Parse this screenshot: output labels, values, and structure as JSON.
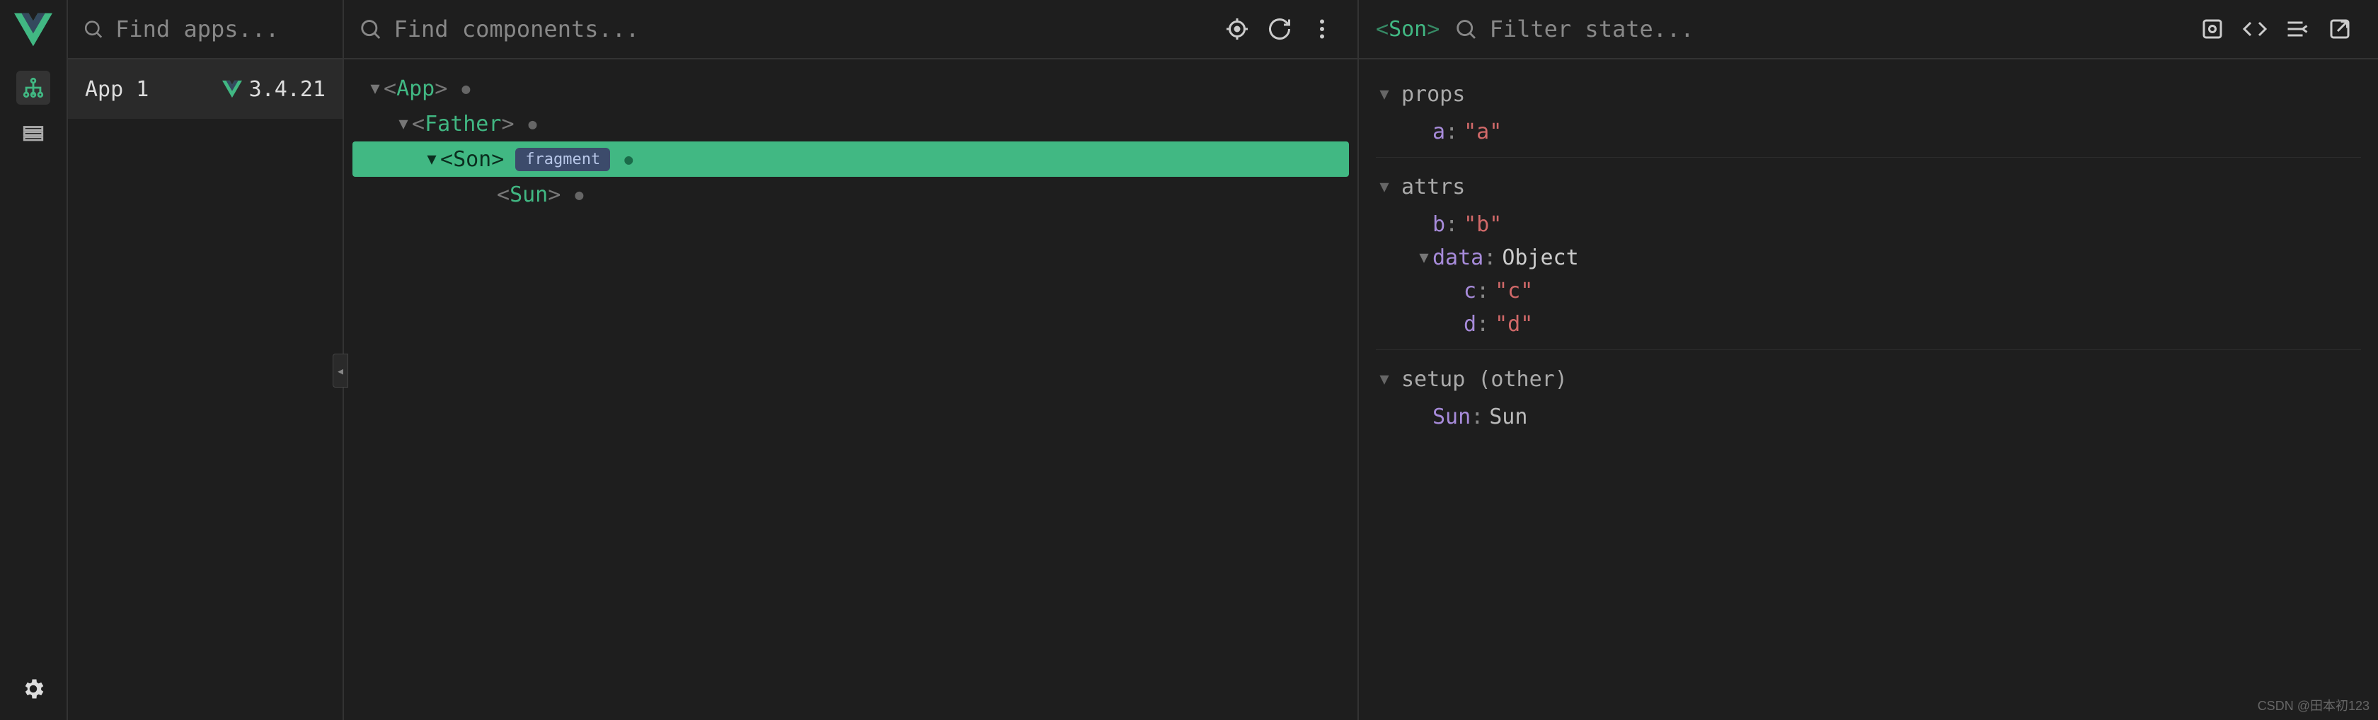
{
  "search": {
    "apps_placeholder": "Find apps...",
    "components_placeholder": "Find components...",
    "state_placeholder": "Filter state..."
  },
  "apps": {
    "selected": {
      "name": "App 1",
      "version": "3.4.21"
    }
  },
  "tree": {
    "nodes": [
      {
        "label": "App",
        "indent": 0,
        "expanded": true,
        "dot": true,
        "selected": false,
        "badge": ""
      },
      {
        "label": "Father",
        "indent": 1,
        "expanded": true,
        "dot": true,
        "selected": false,
        "badge": ""
      },
      {
        "label": "Son",
        "indent": 2,
        "expanded": true,
        "dot": true,
        "selected": true,
        "badge": "fragment"
      },
      {
        "label": "Sun",
        "indent": 3,
        "expanded": false,
        "dot": true,
        "selected": false,
        "badge": ""
      }
    ]
  },
  "state": {
    "selected_component": "Son",
    "sections": {
      "props": {
        "title": "props",
        "items": [
          {
            "key": "a",
            "value": "\"a\"",
            "type": "string"
          }
        ]
      },
      "attrs": {
        "title": "attrs",
        "items": [
          {
            "key": "b",
            "value": "\"b\"",
            "type": "string"
          },
          {
            "key": "data",
            "value": "Object",
            "type": "object",
            "expanded": true,
            "children": [
              {
                "key": "c",
                "value": "\"c\"",
                "type": "string"
              },
              {
                "key": "d",
                "value": "\"d\"",
                "type": "string"
              }
            ]
          }
        ]
      },
      "setup": {
        "title": "setup (other)",
        "items": [
          {
            "key": "Sun",
            "value": "Sun",
            "type": "component"
          }
        ]
      }
    }
  },
  "watermark": "CSDN @田本初123"
}
